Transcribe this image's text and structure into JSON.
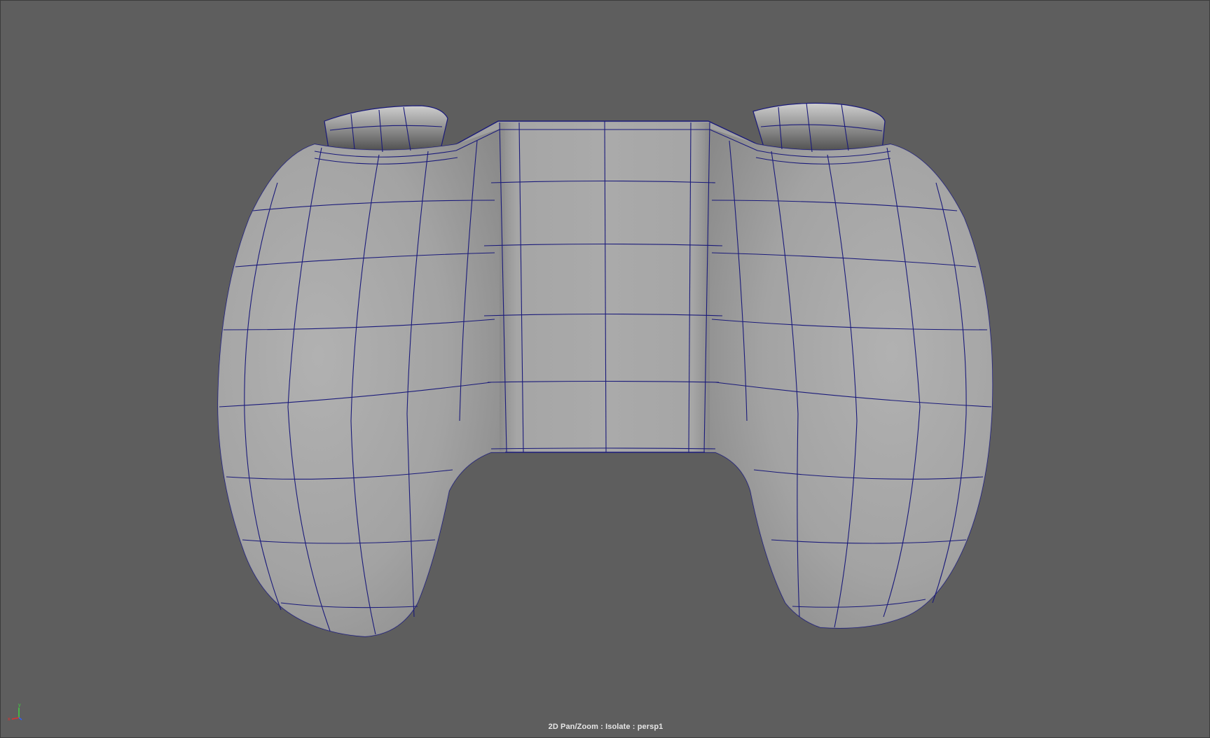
{
  "viewport": {
    "hud_text": "2D Pan/Zoom : Isolate : persp1",
    "camera": "persp1",
    "background_color": "#5e5e5e",
    "wireframe_color": "#1a1a7a",
    "surface_color": "#9e9e9e"
  },
  "axis_gizmo": {
    "x_label": "x",
    "y_label": "y",
    "z_label": "z",
    "x_color": "#e03030",
    "y_color": "#40d040",
    "z_color": "#3060ff"
  },
  "model": {
    "name": "game-controller-mesh",
    "display_mode": "shaded-with-wireframe"
  }
}
